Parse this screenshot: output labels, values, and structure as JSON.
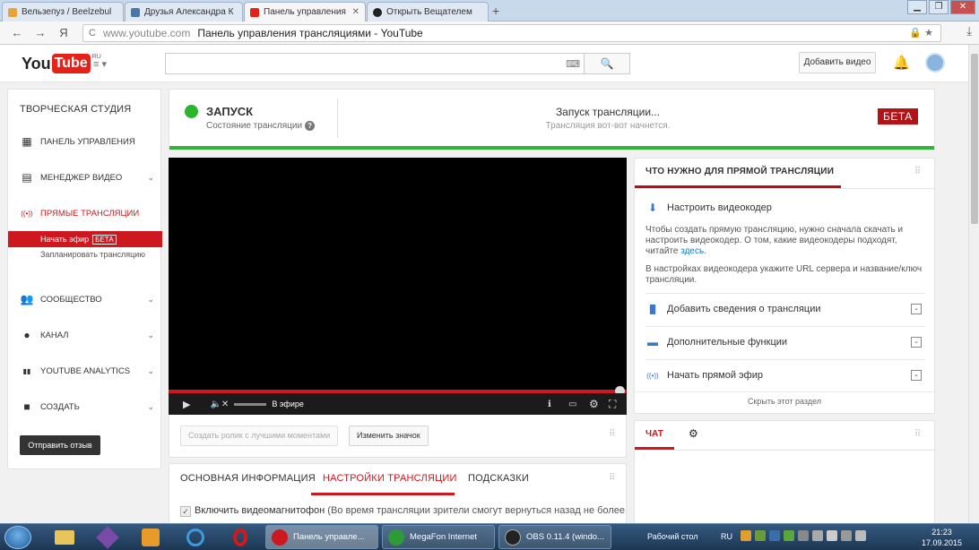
{
  "browser": {
    "tabs": [
      {
        "label": "Вельзепуз / Beelzebul",
        "color": "#e8a33b"
      },
      {
        "label": "Друзья Александра К",
        "color": "#4a76a8"
      },
      {
        "label": "Панель управления т",
        "color": "#e62117"
      },
      {
        "label": "Открыть Вещателем",
        "color": "#222222"
      }
    ],
    "new_tab": "+",
    "window_buttons": {
      "minimize": "▁",
      "maximize": "❐",
      "close": "✕"
    },
    "nav": {
      "back": "←",
      "forward": "→",
      "yandex": "Я",
      "reload": "C"
    },
    "url_host": "www.youtube.com",
    "url_title": "Панель управления трансляциями - YouTube",
    "url_right": "🔒 ★",
    "download": "⤓"
  },
  "header": {
    "logo_you": "You",
    "logo_tube": "Tube",
    "logo_ru": "RU",
    "guide": "≡ ▾",
    "keyboard_icon": "⌨",
    "search_icon": "🔍",
    "add_video": "Добавить видео",
    "bell": "🔔"
  },
  "sidebar": {
    "title": "ТВОРЧЕСКАЯ СТУДИЯ",
    "items": [
      {
        "label": "ПАНЕЛЬ УПРАВЛЕНИЯ",
        "icon": "▦",
        "chevron": ""
      },
      {
        "label": "МЕНЕДЖЕР ВИДЕО",
        "icon": "▤",
        "chevron": "⌄"
      },
      {
        "label": "ПРЯМЫЕ ТРАНСЛЯЦИИ",
        "icon": "((•))",
        "chevron": ""
      },
      {
        "label": "СООБЩЕСТВО",
        "icon": "👥",
        "chevron": "⌄"
      },
      {
        "label": "КАНАЛ",
        "icon": "●",
        "chevron": "⌄"
      },
      {
        "label": "YOUTUBE ANALYTICS",
        "icon": "▮▮",
        "chevron": "⌄"
      },
      {
        "label": "СОЗДАТЬ",
        "icon": "■",
        "chevron": "⌄"
      }
    ],
    "active_sub": "Начать эфир",
    "active_badge": "БЕТА",
    "sub_item": "Запланировать трансляцию",
    "feedback": "Отправить отзыв"
  },
  "status": {
    "title": "ЗАПУСК",
    "subtitle": "Состояние трансляции",
    "help": "?",
    "center_title": "Запуск трансляции...",
    "center_sub": "Трансляция вот-вот начнется.",
    "beta": "БЕТА",
    "state_color": "#2bb52b"
  },
  "player": {
    "play": "▶",
    "volume": "🔈✕",
    "live_label": "В эфире",
    "info": "ℹ",
    "captions": "▭",
    "settings": "⚙",
    "fullscreen": "⛶"
  },
  "below_video": {
    "highlights": "Создать ролик с лучшими моментами",
    "change_thumb": "Изменить значок"
  },
  "tabs": {
    "items": [
      "ОСНОВНАЯ ИНФОРМАЦИЯ",
      "НАСТРОЙКИ ТРАНСЛЯЦИИ",
      "ПОДСКАЗКИ"
    ],
    "active": "НАСТРОЙКИ ТРАНСЛЯЦИИ",
    "checkbox_check": "✓",
    "checkbox_label": "Включить видеомагнитофон",
    "checkbox_hint": "(Во время трансляции зрители смогут вернуться назад не более"
  },
  "right_panel": {
    "title": "ЧТО НУЖНО ДЛЯ ПРЯМОЙ ТРАНСЛЯЦИИ",
    "setup_encoder": "Настроить видеокодер",
    "setup_icon": "⬇",
    "para1": "Чтобы создать прямую трансляцию, нужно сначала скачать и настроить видеокодер. О том, какие видеокодеры подходят, читайте",
    "para1_link": "здесь",
    "para2": "В настройках видеокодера укажите URL сервера и название/ключ трансляции.",
    "rows": [
      {
        "label": "Добавить сведения о трансляции",
        "icon": "▐▌"
      },
      {
        "label": "Дополнительные функции",
        "icon": "▬"
      },
      {
        "label": "Начать прямой эфир",
        "icon": "((•))"
      }
    ],
    "expand": "⌄",
    "hide": "Скрыть этот раздел"
  },
  "chat": {
    "tab": "ЧАТ",
    "gear": "⚙"
  },
  "taskbar": {
    "windows": [
      {
        "label": "Панель управле...",
        "color": "#cc181e"
      },
      {
        "label": "MegaFon Internet",
        "color": "#2e9b3a"
      },
      {
        "label": "OBS 0.11.4 (windo...",
        "color": "#222222"
      }
    ],
    "desktop": "Рабочий стол",
    "lang": "RU",
    "time": "21:23",
    "date": "17.09.2015"
  }
}
